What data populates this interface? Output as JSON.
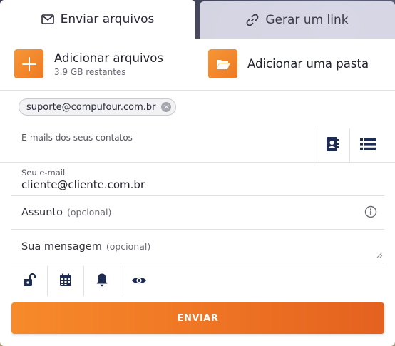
{
  "tabs": {
    "send_label": "Enviar arquivos",
    "link_label": "Gerar um link"
  },
  "add": {
    "files_label": "Adicionar arquivos",
    "files_remaining": "3.9 GB restantes",
    "folder_label": "Adicionar uma pasta"
  },
  "recipients": {
    "chips": [
      "suporte@compufour.com.br"
    ],
    "contacts_placeholder": "E-mails dos seus contatos"
  },
  "email": {
    "label": "Seu e-mail",
    "value": "cliente@cliente.com.br"
  },
  "subject": {
    "label": "Assunto",
    "optional": "(opcional)"
  },
  "message": {
    "label": "Sua mensagem",
    "optional": "(opcional)"
  },
  "send_label": "ENVIAR",
  "colors": {
    "accent": "#f08127",
    "icon_dark": "#1f2c52"
  },
  "icons": {
    "send_tab": "envelope-icon",
    "link_tab": "link-icon",
    "add_files": "plus-icon",
    "add_folder": "folder-open-icon",
    "contacts": "address-book-icon",
    "list": "list-icon",
    "info": "info-icon",
    "options": [
      "unlock-icon",
      "calendar-icon",
      "bell-icon",
      "eye-icon"
    ]
  }
}
